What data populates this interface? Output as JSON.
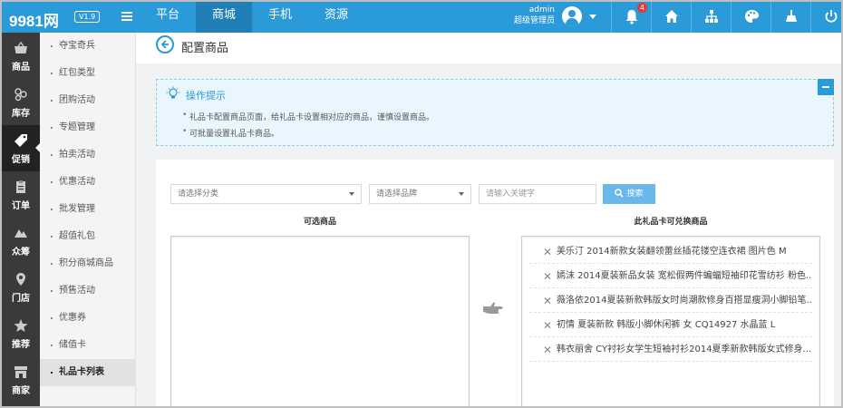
{
  "header": {
    "logo": "9981网",
    "version": "V1.9",
    "nav": [
      "平台",
      "商城",
      "手机",
      "资源"
    ],
    "active_nav": 1,
    "user_name": "admin",
    "user_role": "超级管理员",
    "notification_count": "4",
    "brand_color": "#2a9ad8"
  },
  "sidebar": {
    "items": [
      {
        "label": "商品",
        "icon": "basket-icon"
      },
      {
        "label": "库存",
        "icon": "stock-icon"
      },
      {
        "label": "促销",
        "icon": "tag-icon"
      },
      {
        "label": "订单",
        "icon": "order-icon"
      },
      {
        "label": "众筹",
        "icon": "crowdfund-icon"
      },
      {
        "label": "门店",
        "icon": "location-icon"
      },
      {
        "label": "推荐",
        "icon": "star-icon"
      },
      {
        "label": "商家",
        "icon": "store-icon"
      }
    ],
    "active_index": 2
  },
  "submenu": {
    "items": [
      "夺宝奇兵",
      "红包类型",
      "团购活动",
      "专题管理",
      "拍卖活动",
      "优惠活动",
      "批发管理",
      "超值礼包",
      "积分商城商品",
      "预售活动",
      "优惠券",
      "储值卡",
      "礼品卡列表"
    ],
    "active_index": 12
  },
  "page": {
    "title": "配置商品"
  },
  "tips": {
    "title": "操作提示",
    "lines": [
      "礼品卡配置商品页面，给礼品卡设置相对应的商品，谨慎设置商品。",
      "可批量设置礼品卡商品。"
    ]
  },
  "filters": {
    "category_placeholder": "请选择分类",
    "brand_placeholder": "请选择品牌",
    "keyword_placeholder": "请输入关键字",
    "search_label": "搜索"
  },
  "lists": {
    "available_title": "可选商品",
    "selected_title": "此礼品卡可兑换商品",
    "selected_items": [
      "美乐汀 2014新款女装翻领蕾丝插花镂空连衣裙 图片色 M",
      "嫣沫 2014夏装新品女装 宽松假两件蝙蝠短袖印花雪纺衫 粉色...",
      "薇洛依2014夏装新款韩版女时尚潮款修身百搭显瘦洞小脚铅笔...",
      "初情 夏装新款 韩版小脚休闲裤 女 CQ14927 水晶蓝 L",
      "韩衣丽舍 CY衬衫女学生短袖衬衫2014夏季新款韩版女式修身..."
    ]
  }
}
